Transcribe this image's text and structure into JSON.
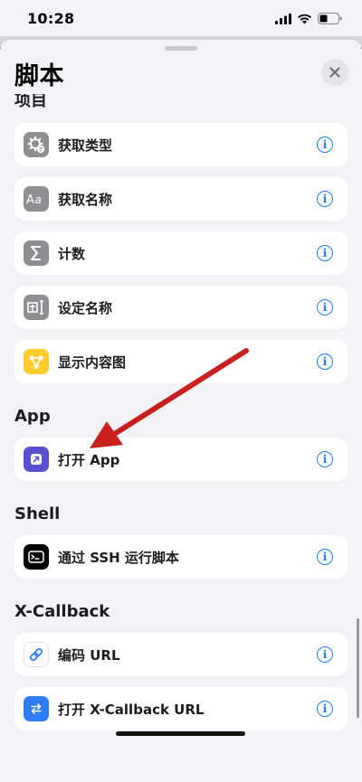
{
  "status": {
    "time": "10:28"
  },
  "sheet": {
    "title": "脚本",
    "partial_header": "项目",
    "sections": [
      {
        "header": "App"
      },
      {
        "header": "Shell"
      },
      {
        "header": "X-Callback"
      }
    ],
    "rows": [
      {
        "label": "获取类型",
        "icon": "gear-question-icon",
        "color": "#8e8e93"
      },
      {
        "label": "获取名称",
        "icon": "text-aa-icon",
        "color": "#8e8e93"
      },
      {
        "label": "计数",
        "icon": "sigma-icon",
        "color": "#8e8e93"
      },
      {
        "label": "设定名称",
        "icon": "text-cursor-icon",
        "color": "#8e8e93"
      },
      {
        "label": "显示内容图",
        "icon": "graph-icon",
        "color": "#ffcc2e"
      },
      {
        "label": "打开 App",
        "icon": "open-app-icon",
        "color": "#5b4fcf"
      },
      {
        "label": "通过 SSH 运行脚本",
        "icon": "terminal-icon",
        "color": "#000000"
      },
      {
        "label": "编码 URL",
        "icon": "link-icon",
        "color": "#ffffff"
      },
      {
        "label": "打开 X-Callback URL",
        "icon": "swap-arrows-icon",
        "color": "#2e7cf6"
      }
    ],
    "info_glyph": "i"
  },
  "annotation": {
    "arrow_color": "#c8201f"
  }
}
